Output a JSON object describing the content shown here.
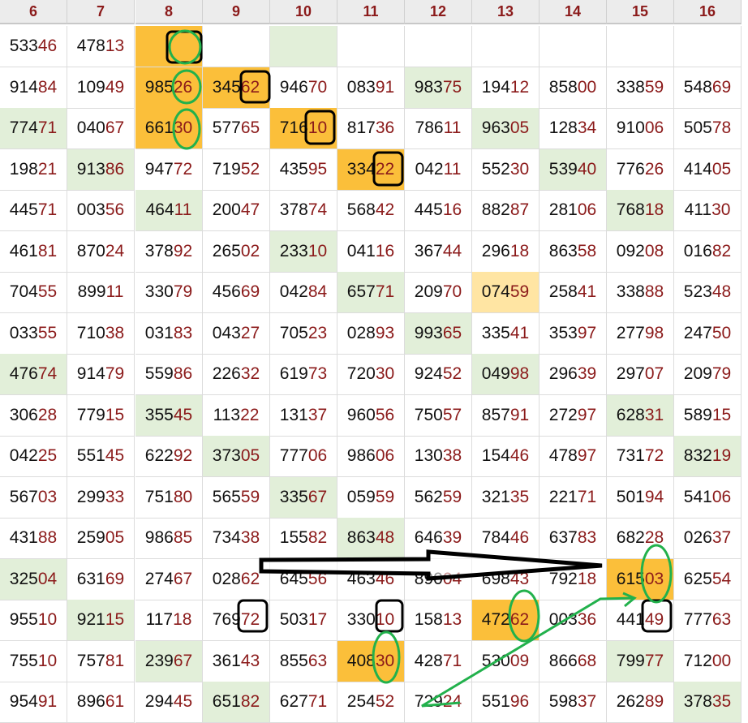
{
  "columns": [
    "6",
    "7",
    "8",
    "9",
    "10",
    "11",
    "12",
    "13",
    "14",
    "15",
    "16"
  ],
  "rows": [
    [
      "53346",
      "47813",
      "",
      "",
      "",
      "",
      "",
      "",
      "",
      "",
      ""
    ],
    [
      "91484",
      "10949",
      "98526",
      "34562",
      "94670",
      "08391",
      "98375",
      "19412",
      "85800",
      "33859",
      "54869"
    ],
    [
      "77471",
      "04067",
      "66130",
      "57765",
      "71610",
      "81736",
      "78611",
      "96305",
      "12834",
      "91006",
      "50578"
    ],
    [
      "19821",
      "91386",
      "94772",
      "71952",
      "43595",
      "33422",
      "04211",
      "55230",
      "53940",
      "77626",
      "41405"
    ],
    [
      "44571",
      "00356",
      "46411",
      "20047",
      "37874",
      "56842",
      "44516",
      "88287",
      "28106",
      "76818",
      "41130"
    ],
    [
      "46181",
      "87024",
      "37892",
      "26502",
      "23310",
      "04116",
      "36744",
      "29618",
      "86358",
      "09208",
      "01682"
    ],
    [
      "70455",
      "89911",
      "33079",
      "45669",
      "04284",
      "65771",
      "20970",
      "07459",
      "25841",
      "33888",
      "52348"
    ],
    [
      "03355",
      "71038",
      "03183",
      "04327",
      "70523",
      "02893",
      "99365",
      "33541",
      "35397",
      "27798",
      "24750"
    ],
    [
      "47674",
      "91479",
      "55986",
      "22632",
      "61973",
      "72030",
      "92452",
      "04998",
      "29639",
      "29707",
      "20979"
    ],
    [
      "30628",
      "77915",
      "35545",
      "11322",
      "13137",
      "96056",
      "75057",
      "85791",
      "27297",
      "62831",
      "58915"
    ],
    [
      "04225",
      "55145",
      "62292",
      "37305",
      "77706",
      "98606",
      "13038",
      "15446",
      "47897",
      "73172",
      "83219"
    ],
    [
      "56703",
      "29933",
      "75180",
      "56559",
      "33567",
      "05959",
      "56259",
      "32135",
      "22171",
      "50194",
      "54106"
    ],
    [
      "43188",
      "25905",
      "98685",
      "73438",
      "15582",
      "86348",
      "64639",
      "78446",
      "63783",
      "68228",
      "02637"
    ],
    [
      "32504",
      "63169",
      "27467",
      "02862",
      "64556",
      "46346",
      "89004",
      "69843",
      "79218",
      "61503",
      "62554"
    ],
    [
      "95510",
      "92115",
      "11718",
      "76972",
      "50317",
      "33010",
      "15813",
      "47262",
      "00336",
      "44149",
      "77763"
    ],
    [
      "75510",
      "75781",
      "23967",
      "36143",
      "85563",
      "40830",
      "42871",
      "53009",
      "86668",
      "79977",
      "71200"
    ],
    [
      "95491",
      "89661",
      "29445",
      "65182",
      "62771",
      "25452",
      "72924",
      "55196",
      "59837",
      "26289",
      "37835"
    ]
  ],
  "highlights": {
    "green": [
      [
        0,
        4
      ],
      [
        1,
        6
      ],
      [
        2,
        0
      ],
      [
        2,
        7
      ],
      [
        3,
        1
      ],
      [
        3,
        8
      ],
      [
        4,
        2
      ],
      [
        4,
        9
      ],
      [
        5,
        4
      ],
      [
        6,
        5
      ],
      [
        7,
        6
      ],
      [
        8,
        0
      ],
      [
        8,
        7
      ],
      [
        9,
        2
      ],
      [
        9,
        9
      ],
      [
        10,
        3
      ],
      [
        10,
        10
      ],
      [
        11,
        4
      ],
      [
        12,
        5
      ],
      [
        13,
        0
      ],
      [
        14,
        1
      ],
      [
        15,
        2
      ],
      [
        15,
        9
      ],
      [
        16,
        3
      ],
      [
        16,
        10
      ]
    ],
    "orange": [
      [
        0,
        2
      ],
      [
        1,
        2
      ],
      [
        1,
        3
      ],
      [
        2,
        2
      ],
      [
        2,
        4
      ],
      [
        3,
        5
      ],
      [
        13,
        9
      ],
      [
        14,
        7
      ],
      [
        15,
        5
      ]
    ],
    "yellow": [
      [
        6,
        7
      ]
    ]
  },
  "palette": {
    "header_bg": "#ececec",
    "header_text": "#8b1a1a",
    "digit_dark": "#111111",
    "digit_red": "#8b1a1a",
    "cell_green": "#e2efd9",
    "cell_orange": "#fbbf3a",
    "cell_yellow": "#ffe5a3",
    "mark_green": "#22b14c",
    "mark_black": "#000000"
  }
}
